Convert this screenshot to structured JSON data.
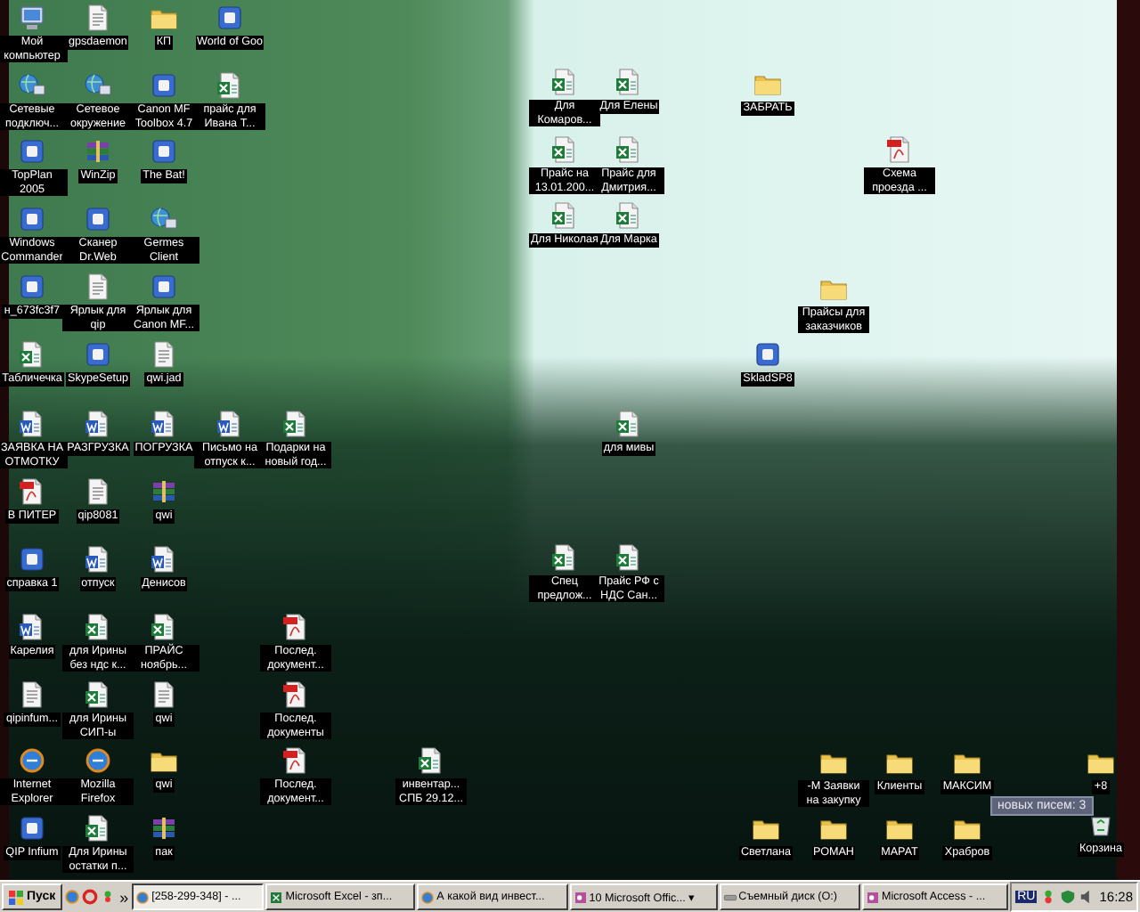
{
  "desktop": {
    "icons": [
      {
        "label": "Мой компьютер",
        "kind": "computer"
      },
      {
        "label": "gpsdaemon",
        "kind": "file"
      },
      {
        "label": "КП",
        "kind": "folder"
      },
      {
        "label": "World of Goo",
        "kind": "program"
      },
      {
        "label": "Сетевые подключ...",
        "kind": "network"
      },
      {
        "label": "Сетевое окружение",
        "kind": "network"
      },
      {
        "label": "Canon MF Toolbox 4.7",
        "kind": "program"
      },
      {
        "label": "прайс для Ивана Т...",
        "kind": "excel"
      },
      {
        "label": "TopPlan 2005",
        "kind": "program"
      },
      {
        "label": "WinZip",
        "kind": "archive"
      },
      {
        "label": "The Bat!",
        "kind": "program"
      },
      {
        "label": "Windows Commander",
        "kind": "program"
      },
      {
        "label": "Сканер Dr.Web",
        "kind": "program"
      },
      {
        "label": "Germes Client",
        "kind": "network"
      },
      {
        "label": "н_673fc3f7",
        "kind": "program"
      },
      {
        "label": "Ярлык для qip",
        "kind": "file"
      },
      {
        "label": "Ярлык для Canon MF...",
        "kind": "program"
      },
      {
        "label": "Табличечка",
        "kind": "excel"
      },
      {
        "label": "SkypeSetup",
        "kind": "program"
      },
      {
        "label": "qwi.jad",
        "kind": "file"
      },
      {
        "label": "ЗАЯВКА НА ОТМОТКУ",
        "kind": "word"
      },
      {
        "label": "РАЗГРУЗКА",
        "kind": "word"
      },
      {
        "label": "ПОГРУЗКА",
        "kind": "word"
      },
      {
        "label": "Письмо на отпуск к...",
        "kind": "word"
      },
      {
        "label": "Подарки на новый год...",
        "kind": "excel"
      },
      {
        "label": "В ПИТЕР",
        "kind": "pdf"
      },
      {
        "label": "qip8081",
        "kind": "file"
      },
      {
        "label": "qwi",
        "kind": "archive"
      },
      {
        "label": "справка 1",
        "kind": "program"
      },
      {
        "label": "отпуск",
        "kind": "word"
      },
      {
        "label": "Денисов",
        "kind": "word"
      },
      {
        "label": "Карелия",
        "kind": "word"
      },
      {
        "label": "для Ирины без ндс к...",
        "kind": "excel"
      },
      {
        "label": "ПРАЙС ноябрь...",
        "kind": "excel"
      },
      {
        "label": "Послед. документ...",
        "kind": "pdf"
      },
      {
        "label": "qipinfum...",
        "kind": "file"
      },
      {
        "label": "для Ирины СИП-ы",
        "kind": "excel"
      },
      {
        "label": "qwi",
        "kind": "file"
      },
      {
        "label": "Послед. документы",
        "kind": "pdf"
      },
      {
        "label": "Internet Explorer",
        "kind": "browser"
      },
      {
        "label": "Mozilla Firefox",
        "kind": "browser"
      },
      {
        "label": "qwi",
        "kind": "folder"
      },
      {
        "label": "Послед. документ...",
        "kind": "pdf"
      },
      {
        "label": "инвентар... СПБ 29.12...",
        "kind": "excel"
      },
      {
        "label": "QIP Infium",
        "kind": "program"
      },
      {
        "label": "Для Ирины остатки п...",
        "kind": "excel"
      },
      {
        "label": "пак",
        "kind": "archive"
      },
      {
        "label": "Для Комаров...",
        "kind": "excel"
      },
      {
        "label": "Для Елены",
        "kind": "excel"
      },
      {
        "label": "Прайс на 13.01.200...",
        "kind": "excel"
      },
      {
        "label": "Прайс для Дмитрия...",
        "kind": "excel"
      },
      {
        "label": "Для Николая",
        "kind": "excel"
      },
      {
        "label": "Для Марка",
        "kind": "excel"
      },
      {
        "label": "для мивы",
        "kind": "excel"
      },
      {
        "label": "Спец предлож...",
        "kind": "excel"
      },
      {
        "label": "Прайс РФ с НДС Сан...",
        "kind": "excel"
      },
      {
        "label": "ЗАБРАТЬ",
        "kind": "folder"
      },
      {
        "label": "Схема проезда ...",
        "kind": "pdf"
      },
      {
        "label": "Прайсы для заказчиков",
        "kind": "folder"
      },
      {
        "label": "SkladSP8",
        "kind": "program"
      },
      {
        "label": "-М Заявки на закупку",
        "kind": "folder"
      },
      {
        "label": "Клиенты",
        "kind": "folder"
      },
      {
        "label": "МАКСИМ",
        "kind": "folder"
      },
      {
        "label": "+8",
        "kind": "folder"
      },
      {
        "label": "Светлана",
        "kind": "folder"
      },
      {
        "label": "РОМАН",
        "kind": "folder"
      },
      {
        "label": "МАРАТ",
        "kind": "folder"
      },
      {
        "label": "Храбров",
        "kind": "folder"
      },
      {
        "label": "Корзина",
        "kind": "recycle"
      }
    ],
    "tooltip": {
      "text": "новых писем: 3"
    }
  },
  "taskbar": {
    "start_button": {
      "label": "Пуск"
    },
    "quick_launch_more": "»",
    "tasks": [
      {
        "label": "[258-299-348] - ...",
        "kind": "browser",
        "selected": true
      },
      {
        "label": "Microsoft Excel - зп...",
        "kind": "excel",
        "selected": false
      },
      {
        "label": "А какой вид инвест...",
        "kind": "browser",
        "selected": false
      },
      {
        "label": "10 Microsoft Offic... ▾",
        "kind": "office",
        "selected": false
      },
      {
        "label": "Съемный диск (O:)",
        "kind": "drive",
        "selected": false
      },
      {
        "label": "Microsoft Access - ...",
        "kind": "office",
        "selected": false
      }
    ],
    "tray": {
      "language": "RU",
      "clock": "16:28"
    }
  }
}
